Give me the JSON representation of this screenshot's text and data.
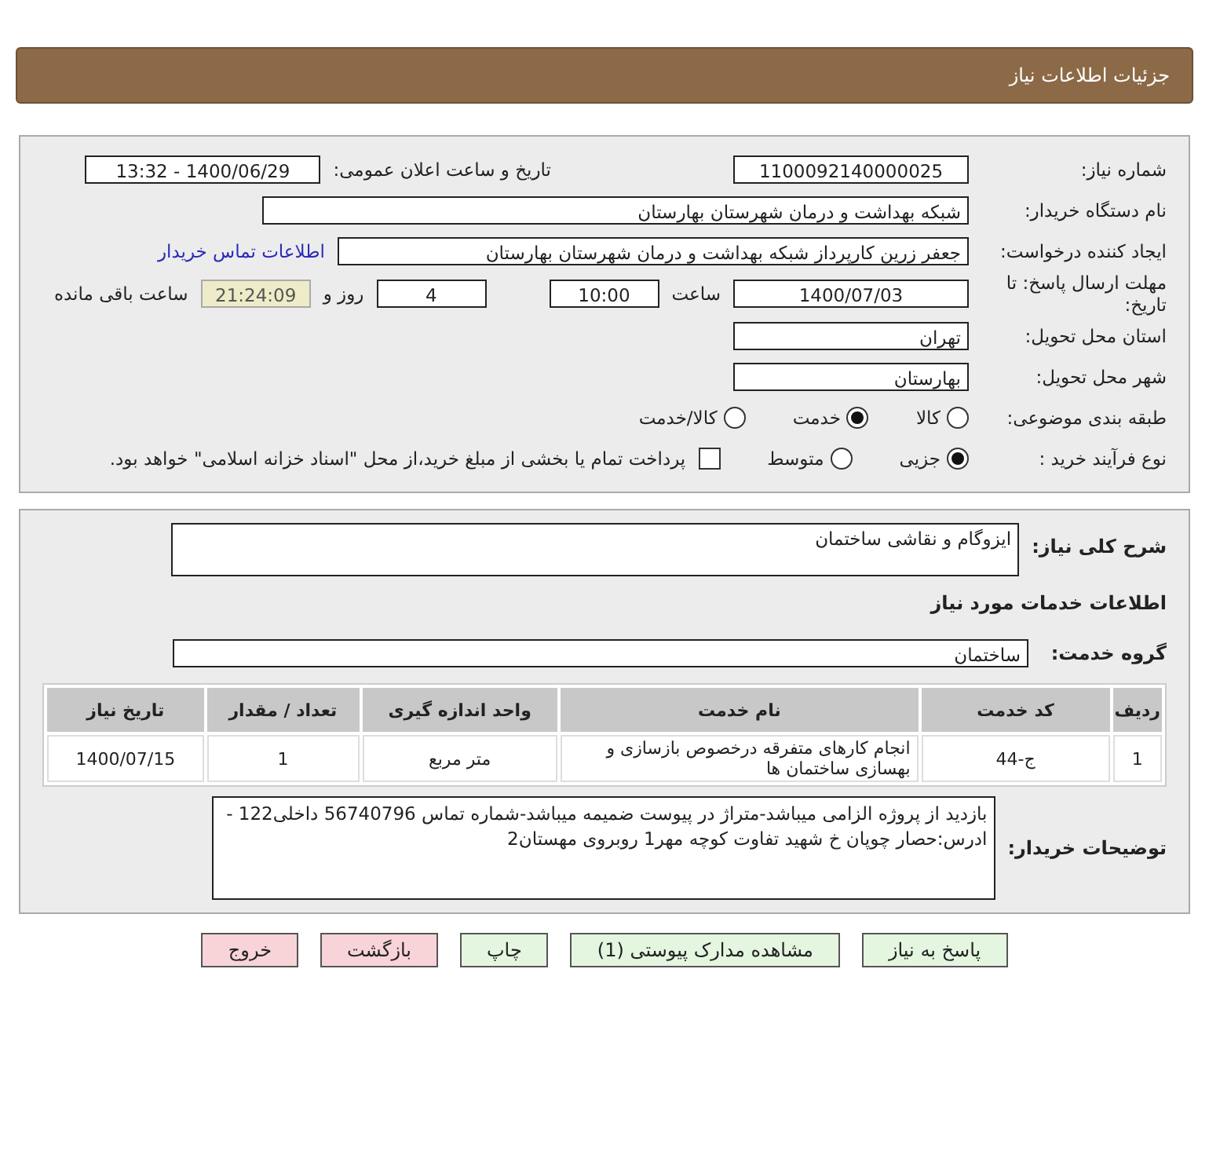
{
  "header": {
    "title": "جزئیات اطلاعات نیاز"
  },
  "details": {
    "need_number": {
      "label": "شماره نیاز:",
      "value": "1100092140000025"
    },
    "announce": {
      "label": "تاریخ و ساعت اعلان عمومی:",
      "value": "1400/06/29 - 13:32"
    },
    "buyer_org": {
      "label": "نام دستگاه خریدار:",
      "value": "شبکه بهداشت و درمان شهرستان بهارستان"
    },
    "requester": {
      "label": "ایجاد کننده درخواست:",
      "value": "جعفر زرین کارپرداز شبکه بهداشت و درمان شهرستان بهارستان",
      "link": "اطلاعات تماس خریدار"
    },
    "deadline": {
      "label": "مهلت ارسال پاسخ: تا تاریخ:",
      "date": "1400/07/03",
      "time_label": "ساعت",
      "time": "10:00",
      "days": "4",
      "days_label": "روز و",
      "remaining": "21:24:09",
      "remaining_label": "ساعت باقی مانده"
    },
    "province": {
      "label": "استان محل تحویل:",
      "value": "تهران"
    },
    "city": {
      "label": "شهر محل تحویل:",
      "value": "بهارستان"
    },
    "category": {
      "label": "طبقه بندی موضوعی:",
      "options": [
        {
          "label": "کالا",
          "selected": false
        },
        {
          "label": "خدمت",
          "selected": true
        },
        {
          "label": "کالا/خدمت",
          "selected": false
        }
      ]
    },
    "purchase_type": {
      "label": "نوع فرآیند خرید :",
      "options": [
        {
          "label": "جزیی",
          "selected": true
        },
        {
          "label": "متوسط",
          "selected": false
        }
      ],
      "treasury": {
        "label": "پرداخت تمام یا بخشی از مبلغ خرید،از محل \"اسناد خزانه اسلامی\" خواهد بود.",
        "checked": false
      }
    }
  },
  "services": {
    "summary": {
      "label": "شرح کلی نیاز:",
      "value": "ایزوگام و نقاشی ساختمان"
    },
    "section_title": "اطلاعات خدمات مورد نیاز",
    "group": {
      "label": "گروه خدمت:",
      "value": "ساختمان"
    },
    "table": {
      "columns": [
        "ردیف",
        "کد خدمت",
        "نام خدمت",
        "واحد اندازه گیری",
        "تعداد / مقدار",
        "تاریخ نیاز"
      ],
      "rows": [
        [
          "1",
          "ج-44",
          "انجام کارهای متفرقه درخصوص بازسازی و بهسازی ساختمان ها",
          "متر مربع",
          "1",
          "1400/07/15"
        ]
      ]
    },
    "notes": {
      "label": "توضیحات خریدار:",
      "lines": [
        "بازدید از پروژه الزامی میباشد-متراژ در پیوست ضمیمه میباشد-شماره تماس 56740796 داخلی122 -",
        "ادرس:حصار چوپان خ شهید تفاوت کوچه مهر1 روبروی مهستان2"
      ]
    }
  },
  "buttons": [
    {
      "label": "پاسخ به نیاز",
      "kind": "normal"
    },
    {
      "label": "مشاهده مدارک پیوستی (1)",
      "kind": "normal"
    },
    {
      "label": "چاپ",
      "kind": "normal"
    },
    {
      "label": "بازگشت",
      "kind": "danger"
    },
    {
      "label": "خروج",
      "kind": "danger"
    }
  ]
}
